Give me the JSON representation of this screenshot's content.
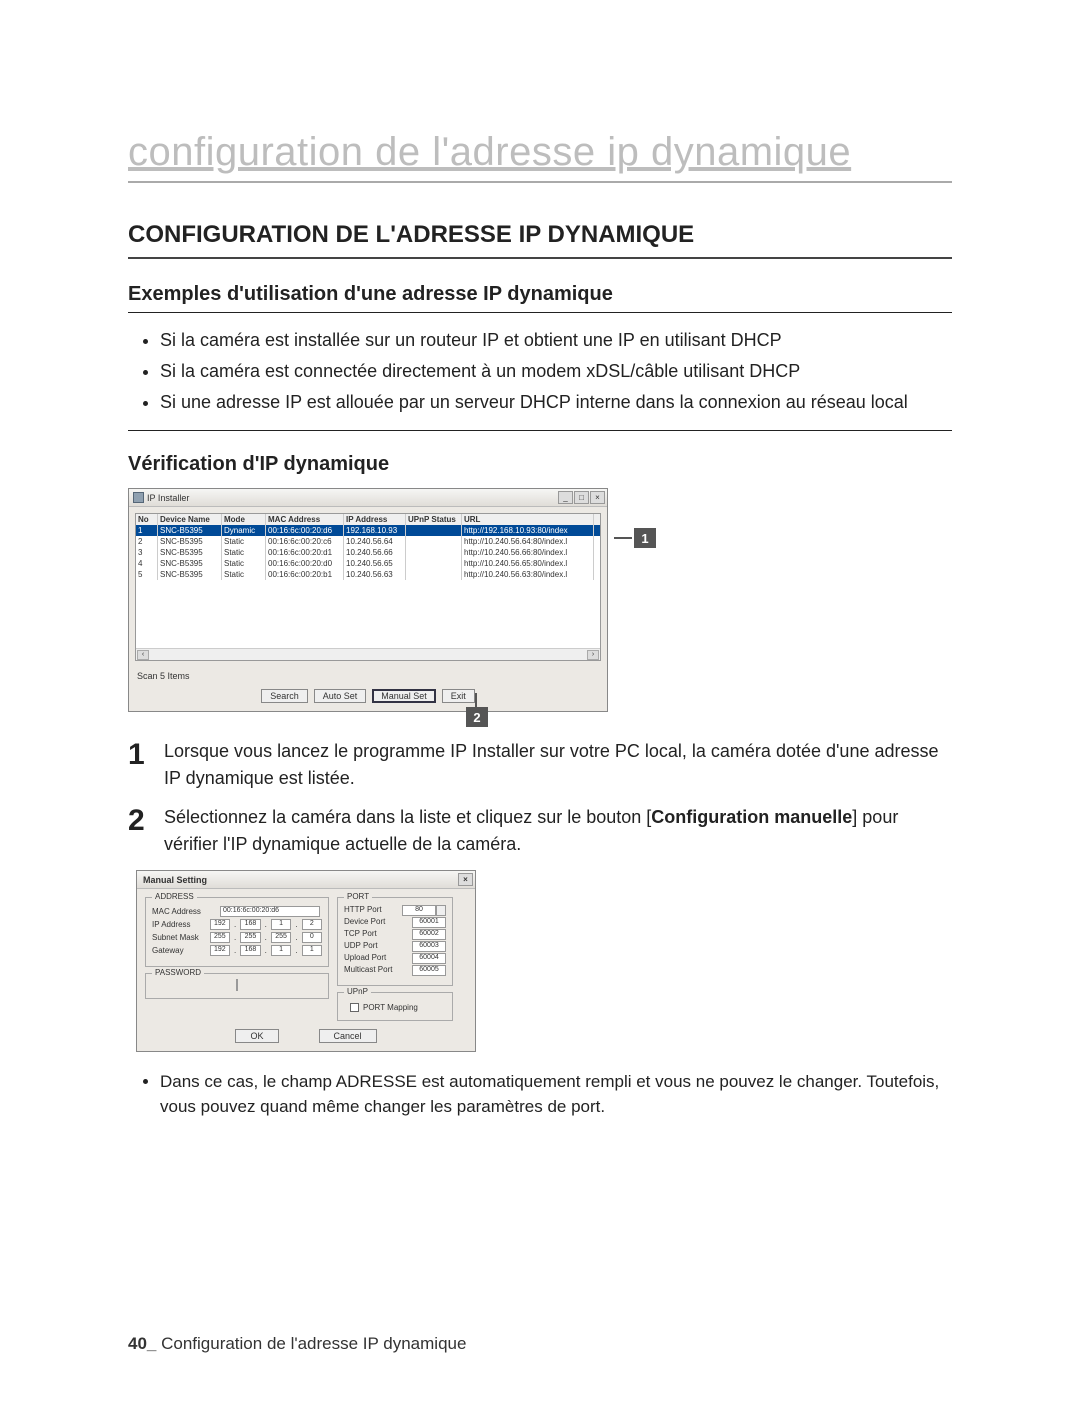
{
  "page_header": "configuration de l'adresse ip dynamique",
  "main_heading": "CONFIGURATION DE L'ADRESSE IP DYNAMIQUE",
  "section_examples": "Exemples d'utilisation d'une adresse IP dynamique",
  "examples": [
    "Si la caméra est installée sur un routeur IP et obtient une IP en utilisant DHCP",
    "Si la caméra est connectée directement à un modem xDSL/câble utilisant DHCP",
    "Si une adresse IP est allouée par un serveur DHCP interne dans la connexion au réseau local"
  ],
  "section_verify": "Vérification d'IP dynamique",
  "ip_installer": {
    "title": "IP Installer",
    "columns": [
      "No",
      "Device Name",
      "Mode",
      "MAC Address",
      "IP Address",
      "UPnP Status",
      "URL"
    ],
    "rows": [
      {
        "no": "1",
        "name": "SNC-B5395",
        "mode": "Dynamic",
        "mac": "00:16:6c:00:20:d6",
        "ip": "192.168.10.93",
        "upnp": "",
        "url": "http://192.168.10.93:80/index"
      },
      {
        "no": "2",
        "name": "SNC-B5395",
        "mode": "Static",
        "mac": "00:16:6c:00:20:c6",
        "ip": "10.240.56.64",
        "upnp": "",
        "url": "http://10.240.56.64:80/index.l"
      },
      {
        "no": "3",
        "name": "SNC-B5395",
        "mode": "Static",
        "mac": "00:16:6c:00:20:d1",
        "ip": "10.240.56.66",
        "upnp": "",
        "url": "http://10.240.56.66:80/index.l"
      },
      {
        "no": "4",
        "name": "SNC-B5395",
        "mode": "Static",
        "mac": "00:16:6c:00:20:d0",
        "ip": "10.240.56.65",
        "upnp": "",
        "url": "http://10.240.56.65:80/index.l"
      },
      {
        "no": "5",
        "name": "SNC-B5395",
        "mode": "Static",
        "mac": "00:16:6c:00:20:b1",
        "ip": "10.240.56.63",
        "upnp": "",
        "url": "http://10.240.56.63:80/index.l"
      }
    ],
    "scan": "Scan 5 Items",
    "buttons": {
      "search": "Search",
      "auto": "Auto Set",
      "manual": "Manual Set",
      "exit": "Exit"
    }
  },
  "callouts": {
    "one": "1",
    "two": "2"
  },
  "steps": [
    "Lorsque vous lancez le programme IP Installer sur votre PC local, la caméra dotée d'une adresse IP dynamique est listée.",
    "Sélectionnez la caméra dans la liste et cliquez sur le bouton [Configuration manuelle] pour vérifier l'IP dynamique actuelle de la caméra."
  ],
  "step_numbers": {
    "one": "1",
    "two": "2"
  },
  "step2_bold": "Configuration manuelle",
  "manual_setting": {
    "title": "Manual Setting",
    "address_legend": "ADDRESS",
    "mac_label": "MAC Address",
    "mac_value": "00:16:6c:00:20:d6",
    "ip_label": "IP Address",
    "ip_value": [
      "192",
      "168",
      "1",
      "2"
    ],
    "subnet_label": "Subnet Mask",
    "subnet_value": [
      "255",
      "255",
      "255",
      "0"
    ],
    "gateway_label": "Gateway",
    "gateway_value": [
      "192",
      "168",
      "1",
      "1"
    ],
    "password_legend": "PASSWORD",
    "port_legend": "PORT",
    "ports": [
      {
        "label": "HTTP Port",
        "val": "80"
      },
      {
        "label": "Device Port",
        "val": "60001"
      },
      {
        "label": "TCP Port",
        "val": "60002"
      },
      {
        "label": "UDP Port",
        "val": "60003"
      },
      {
        "label": "Upload Port",
        "val": "60004"
      },
      {
        "label": "Multicast Port",
        "val": "60005"
      }
    ],
    "upnp_legend": "UPnP",
    "upnp_label": "PORT Mapping",
    "ok": "OK",
    "cancel": "Cancel"
  },
  "note": "Dans ce cas, le champ ADRESSE est automatiquement rempli et vous ne pouvez le changer. Toutefois, vous pouvez quand même changer les paramètres de port.",
  "footer_page": "40_",
  "footer_text": " Configuration de l'adresse IP dynamique"
}
